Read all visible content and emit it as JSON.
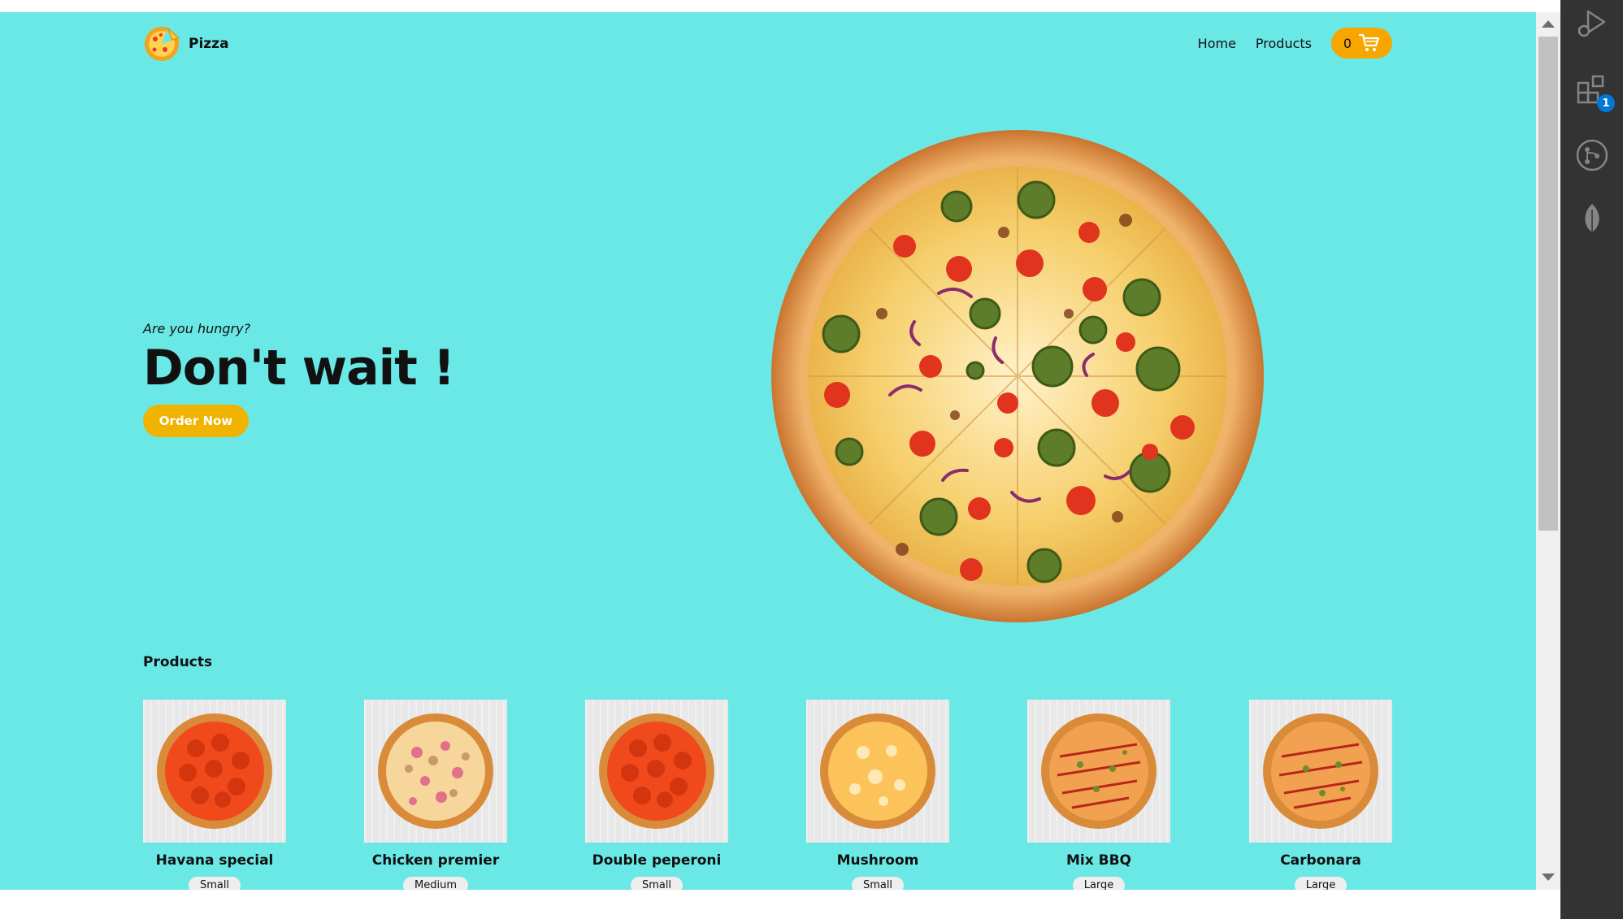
{
  "brand": {
    "name": "Pizza"
  },
  "nav": {
    "home": "Home",
    "products": "Products",
    "cart_count": "0"
  },
  "hero": {
    "subtitle": "Are you hungry?",
    "title": "Don't wait !",
    "button": "Order Now"
  },
  "products": {
    "heading": "Products",
    "items": [
      {
        "name": "Havana special",
        "size": "Small",
        "topping": "pepperoni"
      },
      {
        "name": "Chicken premier",
        "size": "Medium",
        "topping": "chicken"
      },
      {
        "name": "Double peperoni",
        "size": "Small",
        "topping": "pepperoni"
      },
      {
        "name": "Mushroom",
        "size": "Small",
        "topping": "cheese"
      },
      {
        "name": "Mix BBQ",
        "size": "Large",
        "topping": "bbq"
      },
      {
        "name": "Carbonara",
        "size": "Large",
        "topping": "bbq"
      }
    ]
  },
  "activity_bar": {
    "extensions_badge": "1"
  },
  "colors": {
    "page_bg": "#6ae8e6",
    "accent": "#f7a600",
    "order_button": "#f0b300",
    "activity_bar": "#333333",
    "badge": "#0078d4"
  }
}
